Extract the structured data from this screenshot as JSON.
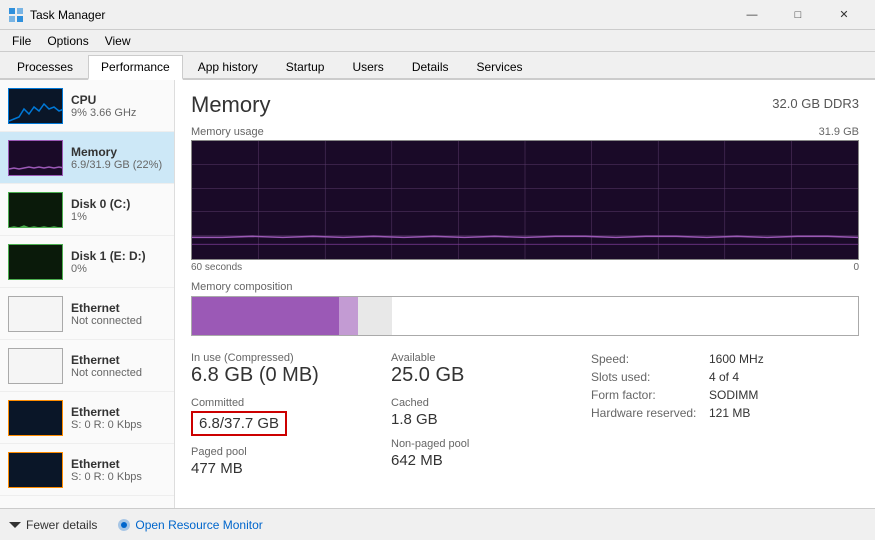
{
  "titleBar": {
    "icon": "📊",
    "title": "Task Manager",
    "minBtn": "—",
    "maxBtn": "□",
    "closeBtn": "✕"
  },
  "menuBar": {
    "items": [
      "File",
      "Options",
      "View"
    ]
  },
  "tabs": [
    {
      "label": "Processes",
      "active": false
    },
    {
      "label": "Performance",
      "active": true
    },
    {
      "label": "App history",
      "active": false
    },
    {
      "label": "Startup",
      "active": false
    },
    {
      "label": "Users",
      "active": false
    },
    {
      "label": "Details",
      "active": false
    },
    {
      "label": "Services",
      "active": false
    }
  ],
  "sidebar": {
    "items": [
      {
        "id": "cpu",
        "name": "CPU",
        "value": "9% 3.66 GHz",
        "graphType": "cpu"
      },
      {
        "id": "memory",
        "name": "Memory",
        "value": "6.9/31.9 GB (22%)",
        "graphType": "mem",
        "active": true
      },
      {
        "id": "disk0",
        "name": "Disk 0 (C:)",
        "value": "1%",
        "graphType": "disk"
      },
      {
        "id": "disk1",
        "name": "Disk 1 (E: D:)",
        "value": "0%",
        "graphType": "disk"
      },
      {
        "id": "eth1",
        "name": "Ethernet",
        "value": "Not connected",
        "graphType": "eth"
      },
      {
        "id": "eth2",
        "name": "Ethernet",
        "value": "Not connected",
        "graphType": "eth"
      },
      {
        "id": "eth3",
        "name": "Ethernet",
        "value": "S: 0 R: 0 Kbps",
        "graphType": "eth-active"
      },
      {
        "id": "eth4",
        "name": "Ethernet",
        "value": "S: 0 R: 0 Kbps",
        "graphType": "eth-active"
      }
    ]
  },
  "panel": {
    "title": "Memory",
    "subtitle": "32.0 GB DDR3",
    "chartLabel": "Memory usage",
    "chartMax": "31.9 GB",
    "timeStart": "60 seconds",
    "timeEnd": "0",
    "compLabel": "Memory composition",
    "stats": {
      "inUseLabel": "In use (Compressed)",
      "inUseValue": "6.8 GB (0 MB)",
      "availableLabel": "Available",
      "availableValue": "25.0 GB",
      "committedLabel": "Committed",
      "committedValue": "6.8/37.7 GB",
      "cachedLabel": "Cached",
      "cachedValue": "1.8 GB",
      "pagedPoolLabel": "Paged pool",
      "pagedPoolValue": "477 MB",
      "nonPagedPoolLabel": "Non-paged pool",
      "nonPagedPoolValue": "642 MB"
    },
    "rightStats": {
      "speedLabel": "Speed:",
      "speedValue": "1600 MHz",
      "slotsLabel": "Slots used:",
      "slotsValue": "4 of 4",
      "formLabel": "Form factor:",
      "formValue": "SODIMM",
      "hwLabel": "Hardware reserved:",
      "hwValue": "121 MB"
    }
  },
  "bottomBar": {
    "fewerDetails": "Fewer details",
    "openResourceMonitor": "Open Resource Monitor"
  }
}
